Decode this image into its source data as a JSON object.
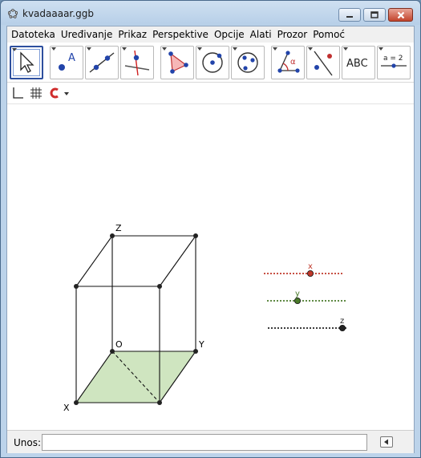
{
  "window": {
    "title": "kvadaaaar.ggb",
    "controls": [
      "minimize",
      "maximize",
      "close"
    ]
  },
  "menu": [
    "Datoteka",
    "Uređivanje",
    "Prikaz",
    "Perspektive",
    "Opcije",
    "Alati",
    "Prozor",
    "Pomoć"
  ],
  "toolbar": {
    "tools": [
      {
        "icon": "move-arrow-icon",
        "active": true
      },
      {
        "icon": "new-point-icon",
        "label": "A"
      },
      {
        "icon": "line-through-points-icon"
      },
      {
        "icon": "perpendicular-line-icon"
      },
      {
        "icon": "polygon-icon"
      },
      {
        "icon": "circle-center-point-icon"
      },
      {
        "icon": "circle-three-points-icon"
      },
      {
        "icon": "angle-icon",
        "label": "α"
      },
      {
        "icon": "reflect-about-line-icon"
      },
      {
        "icon": "insert-text-icon",
        "label": "ABC"
      },
      {
        "icon": "slider-icon",
        "label": "a = 2"
      }
    ]
  },
  "stylebar": {
    "icons": [
      "axes-toggle-icon",
      "grid-toggle-icon",
      "point-capture-icon"
    ]
  },
  "graphics": {
    "point_labels": {
      "z": "Z",
      "o": "O",
      "y": "Y",
      "x": "X"
    },
    "sliders": [
      {
        "name": "x",
        "color": "#c0392b",
        "value_fraction": 0.58
      },
      {
        "name": "y",
        "color": "#4a7a2a",
        "value_fraction": 0.38
      },
      {
        "name": "z",
        "color": "#222222",
        "value_fraction": 0.93
      }
    ],
    "base_fill_color": "#cfe5c0"
  },
  "input_bar": {
    "label": "Unos:",
    "value": "",
    "placeholder": ""
  }
}
